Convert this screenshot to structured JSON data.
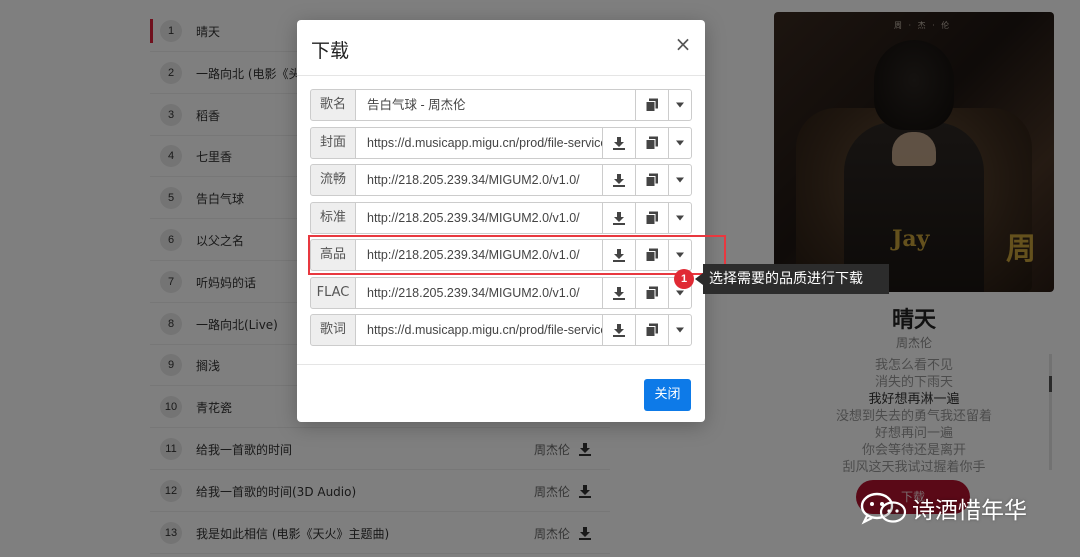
{
  "songs": [
    {
      "num": "1",
      "title": "晴天",
      "artist": "",
      "active": true
    },
    {
      "num": "2",
      "title": "一路向北 (电影《头文字D》插曲)",
      "artist": ""
    },
    {
      "num": "3",
      "title": "稻香",
      "artist": ""
    },
    {
      "num": "4",
      "title": "七里香",
      "artist": ""
    },
    {
      "num": "5",
      "title": "告白气球",
      "artist": ""
    },
    {
      "num": "6",
      "title": "以父之名",
      "artist": ""
    },
    {
      "num": "7",
      "title": "听妈妈的话",
      "artist": ""
    },
    {
      "num": "8",
      "title": "一路向北(Live)",
      "artist": ""
    },
    {
      "num": "9",
      "title": "搁浅",
      "artist": ""
    },
    {
      "num": "10",
      "title": "青花瓷",
      "artist": ""
    },
    {
      "num": "11",
      "title": "给我一首歌的时间",
      "artist": "周杰伦"
    },
    {
      "num": "12",
      "title": "给我一首歌的时间(3D Audio)",
      "artist": "周杰伦"
    },
    {
      "num": "13",
      "title": "我是如此相信 (电影《天火》主题曲)",
      "artist": "周杰伦"
    }
  ],
  "player": {
    "album_top_text": "周 · 杰 · 伦",
    "album_brand_big": "周",
    "album_brand_small": "Jay",
    "song_title": "晴天",
    "artist": "周杰伦",
    "lyrics": [
      {
        "text": "我怎么看不见",
        "current": false
      },
      {
        "text": "消失的下雨天",
        "current": false
      },
      {
        "text": "我好想再淋一遍",
        "current": true
      },
      {
        "text": "没想到失去的勇气我还留着",
        "current": false
      },
      {
        "text": "好想再问一遍",
        "current": false
      },
      {
        "text": "你会等待还是离开",
        "current": false
      },
      {
        "text": "刮风这天我试过握着你手",
        "current": false
      }
    ],
    "download_label": "下载"
  },
  "modal": {
    "title": "下载",
    "close_symbol": "×",
    "rows": [
      {
        "label": "歌名",
        "value": "告白气球 - 周杰伦",
        "has_download": false
      },
      {
        "label": "封面",
        "value": "https://d.musicapp.migu.cn/prod/file-service/",
        "has_download": true
      },
      {
        "label": "流畅",
        "value": "http://218.205.239.34/MIGUM2.0/v1.0/",
        "has_download": true
      },
      {
        "label": "标准",
        "value": "http://218.205.239.34/MIGUM2.0/v1.0/",
        "has_download": true
      },
      {
        "label": "高品",
        "value": "http://218.205.239.34/MIGUM2.0/v1.0/",
        "has_download": true
      },
      {
        "label": "FLAC",
        "value": "http://218.205.239.34/MIGUM2.0/v1.0/",
        "has_download": true
      },
      {
        "label": "歌词",
        "value": "https://d.musicapp.migu.cn/prod/file-service/",
        "has_download": true
      }
    ],
    "footer_close_label": "关闭"
  },
  "annotation": {
    "badge": "1",
    "text": "选择需要的品质进行下载"
  },
  "watermark": {
    "text": "诗酒惜年华"
  },
  "colors": {
    "accent_red": "#e0203a",
    "primary_blue": "#0d7ae8",
    "overlay": "rgba(0,0,0,0.5)"
  }
}
